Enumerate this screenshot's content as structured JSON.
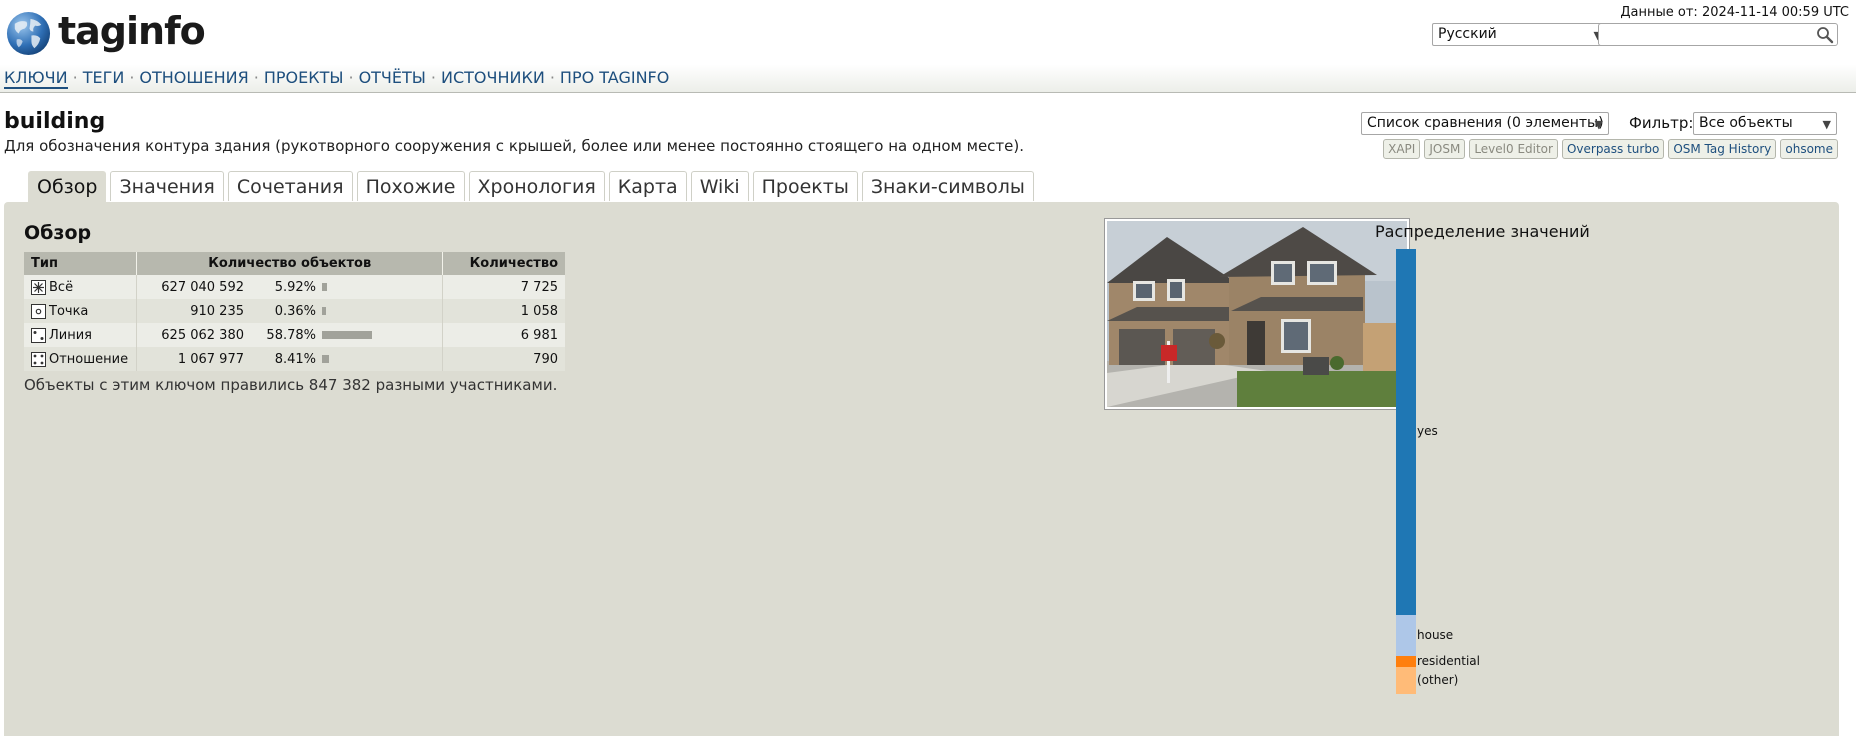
{
  "header": {
    "logo_text_a": "tag",
    "logo_text_b": "info",
    "data_date": "Данные от: 2024-11-14 00:59 UTC",
    "language": "Русский",
    "search_value": ""
  },
  "nav": {
    "items": [
      "КЛЮЧИ",
      "ТЕГИ",
      "ОТНОШЕНИЯ",
      "ПРОЕКТЫ",
      "ОТЧЁТЫ",
      "ИСТОЧНИКИ",
      "ПРО TAGINFO"
    ],
    "separator": "·"
  },
  "page": {
    "title": "building",
    "description": "Для обозначения контура здания (рукотворного сооружения с крышей, более или менее постоянно стоящего на одном месте).",
    "compare": "Список сравнения (0 элементы)",
    "filter_label": "Фильтр:",
    "filter_value": "Все объекты",
    "external_buttons": [
      "XAPI",
      "JOSM",
      "Level0 Editor",
      "Overpass turbo",
      "OSM Tag History",
      "ohsome"
    ]
  },
  "tabs": [
    "Обзор",
    "Значения",
    "Сочетания",
    "Похожие",
    "Хронология",
    "Карта",
    "Wiki",
    "Проекты",
    "Знаки-символы"
  ],
  "overview": {
    "heading": "Обзор",
    "columns": [
      "Тип",
      "Количество объектов",
      "Количество"
    ],
    "rows": [
      {
        "type": "Всё",
        "icon": "all-icon",
        "objects": "627 040 592",
        "percent": "5.92%",
        "fraction": 0.0592,
        "values": "7 725"
      },
      {
        "type": "Точка",
        "icon": "node-icon",
        "objects": "910 235",
        "percent": "0.36%",
        "fraction": 0.0036,
        "values": "1 058"
      },
      {
        "type": "Линия",
        "icon": "way-icon",
        "objects": "625 062 380",
        "percent": "58.78%",
        "fraction": 0.5878,
        "values": "6 981"
      },
      {
        "type": "Отношение",
        "icon": "relation-icon",
        "objects": "1 067 977",
        "percent": "8.41%",
        "fraction": 0.0841,
        "values": "790"
      }
    ],
    "editors_note": "Объекты с этим ключом правились 847 382 разными участниками."
  },
  "distribution": {
    "title": "Распределение значений",
    "segments": [
      {
        "label": "yes",
        "fraction": 0.8,
        "color": "#1f77b4"
      },
      {
        "label": "house",
        "fraction": 0.09,
        "color": "#aec7e8"
      },
      {
        "label": "residential",
        "fraction": 0.025,
        "color": "#ff7f0e"
      },
      {
        "label": "(other)",
        "fraction": 0.06,
        "color": "#ffbb78"
      }
    ]
  }
}
